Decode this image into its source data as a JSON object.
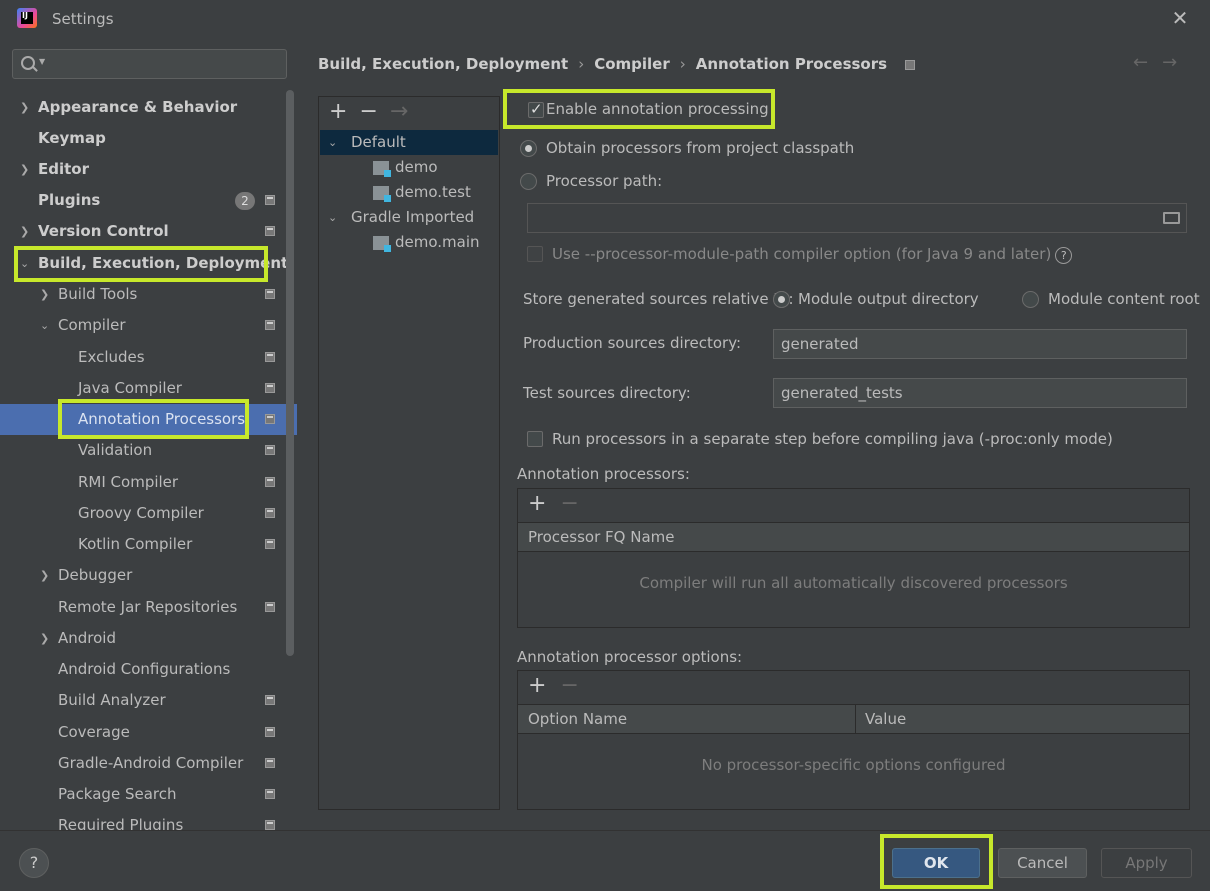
{
  "window": {
    "title": "Settings",
    "app_icon_text": "IJ"
  },
  "search": {
    "placeholder": ""
  },
  "sidebar": {
    "items": [
      {
        "label": "Appearance & Behavior"
      },
      {
        "label": "Keymap"
      },
      {
        "label": "Editor"
      },
      {
        "label": "Plugins",
        "badge": "2"
      },
      {
        "label": "Version Control"
      },
      {
        "label": "Build, Execution, Deployment"
      },
      {
        "label": "Build Tools"
      },
      {
        "label": "Compiler"
      },
      {
        "label": "Excludes"
      },
      {
        "label": "Java Compiler"
      },
      {
        "label": "Annotation Processors"
      },
      {
        "label": "Validation"
      },
      {
        "label": "RMI Compiler"
      },
      {
        "label": "Groovy Compiler"
      },
      {
        "label": "Kotlin Compiler"
      },
      {
        "label": "Debugger"
      },
      {
        "label": "Remote Jar Repositories"
      },
      {
        "label": "Android"
      },
      {
        "label": "Android Configurations"
      },
      {
        "label": "Build Analyzer"
      },
      {
        "label": "Coverage"
      },
      {
        "label": "Gradle-Android Compiler"
      },
      {
        "label": "Package Search"
      },
      {
        "label": "Required Plugins"
      }
    ]
  },
  "breadcrumb": {
    "items": [
      "Build, Execution, Deployment",
      "Compiler",
      "Annotation Processors"
    ]
  },
  "profiles": {
    "toolbar": {
      "add": "+",
      "remove": "−",
      "move": "→"
    },
    "items": [
      {
        "label": "Default"
      },
      {
        "label": "demo"
      },
      {
        "label": "demo.test"
      },
      {
        "label": "Gradle Imported"
      },
      {
        "label": "demo.main"
      }
    ]
  },
  "options": {
    "enable_label": "Enable annotation processing",
    "obtain_label": "Obtain processors from project classpath",
    "processor_path_label": "Processor path:",
    "processor_path_value": "",
    "module_path_label": "Use --processor-module-path compiler option (for Java 9 and later)",
    "store_label": "Store generated sources relative to:",
    "module_output_label": "Module output directory",
    "module_content_label": "Module content root",
    "production_label": "Production sources directory:",
    "production_value": "generated",
    "test_label": "Test sources directory:",
    "test_value": "generated_tests",
    "separate_step_label": "Run processors in a separate step before compiling java (-proc:only mode)"
  },
  "processors_table": {
    "title": "Annotation processors:",
    "add": "+",
    "remove": "−",
    "column": "Processor FQ Name",
    "empty": "Compiler will run all automatically discovered processors"
  },
  "options_table": {
    "title": "Annotation processor options:",
    "add": "+",
    "remove": "−",
    "columns": [
      "Option Name",
      "Value"
    ],
    "empty": "No processor-specific options configured"
  },
  "buttons": {
    "help": "?",
    "ok": "OK",
    "cancel": "Cancel",
    "apply": "Apply"
  },
  "colors": {
    "background": "#3c3f41",
    "selection": "#4b6eaf",
    "highlight": "#c7e82b",
    "ok_button": "#365880"
  }
}
